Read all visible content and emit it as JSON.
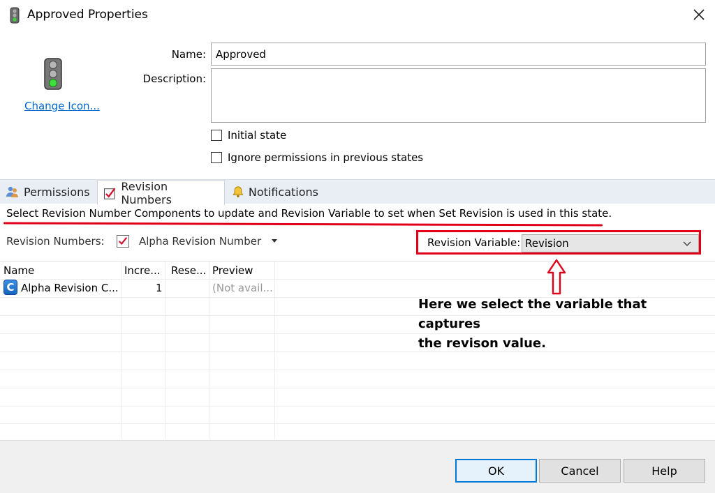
{
  "window": {
    "title": "Approved Properties"
  },
  "general": {
    "change_icon": "Change Icon...",
    "name_label": "Name:",
    "name_value": "Approved",
    "description_label": "Description:",
    "description_value": "",
    "initial_state": "Initial state",
    "ignore_permissions": "Ignore permissions in previous states"
  },
  "tabs": [
    {
      "label": "Permissions",
      "icon": "users-icon"
    },
    {
      "label": "Revision Numbers",
      "icon": "checkbox-icon"
    },
    {
      "label": "Notifications",
      "icon": "bell-icon"
    }
  ],
  "revision": {
    "info": "Select Revision Number Components to update and Revision Variable to set when Set Revision is used in this state.",
    "numbers_label": "Revision Numbers:",
    "numbers_value": "Alpha Revision Number",
    "variable_label": "Revision Variable:",
    "variable_value": "Revision"
  },
  "grid": {
    "columns": [
      "Name",
      "Incre...",
      "Rese...",
      "Preview"
    ],
    "rows": [
      {
        "icon_letter": "C",
        "name": "Alpha Revision C...",
        "increment": "1",
        "reset": "",
        "preview": "(Not avail..."
      }
    ]
  },
  "annotation": {
    "line1": "Here we select the variable that captures",
    "line2": "the revison value."
  },
  "buttons": {
    "ok": "OK",
    "cancel": "Cancel",
    "help": "Help"
  },
  "colors": {
    "accent": "#0078d7",
    "annotation_red": "#e0001a",
    "link": "#0066cc"
  }
}
